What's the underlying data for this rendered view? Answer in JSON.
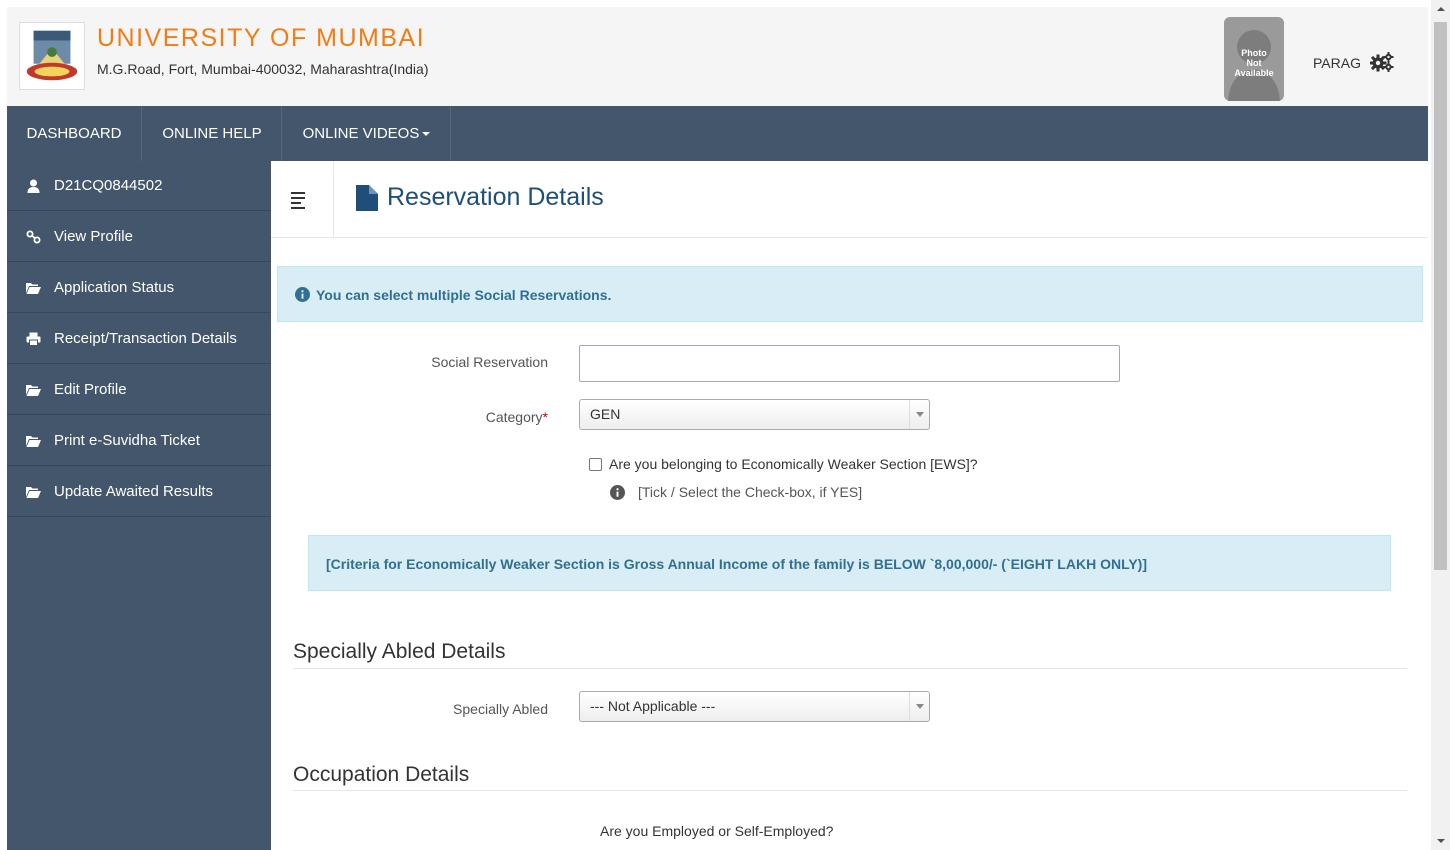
{
  "header": {
    "university_name": "UNIVERSITY OF MUMBAI",
    "address": "M.G.Road, Fort, Mumbai-400032, Maharashtra(India)",
    "photo_placeholder": [
      "Photo",
      "Not",
      "Available"
    ],
    "user_name": "PARAG",
    "settings_icon": "gears-icon",
    "brand_color": "#ef7d16"
  },
  "topnav": {
    "items": [
      {
        "label": "DASHBOARD"
      },
      {
        "label": "ONLINE HELP"
      },
      {
        "label": "ONLINE VIDEOS",
        "dropdown": true
      }
    ]
  },
  "sidebar": {
    "items": [
      {
        "label": "D21CQ0844502",
        "icon": "user-icon"
      },
      {
        "label": "View Profile",
        "icon": "link-icon"
      },
      {
        "label": "Application Status",
        "icon": "folder-icon"
      },
      {
        "label": "Receipt/Transaction Details",
        "icon": "print-icon"
      },
      {
        "label": "Edit Profile",
        "icon": "folder-icon"
      },
      {
        "label": "Print e-Suvidha Ticket",
        "icon": "folder-icon"
      },
      {
        "label": "Update Awaited Results",
        "icon": "folder-icon"
      }
    ],
    "background": "#43566b"
  },
  "page": {
    "title": "Reservation Details",
    "info_alert": "You can select multiple Social Reservations.",
    "social_reservation": {
      "label": "Social Reservation",
      "value": ""
    },
    "category": {
      "label": "Category",
      "required_mark": "*",
      "value": "GEN"
    },
    "ews": {
      "label": "Are you belonging to Economically Weaker Section [EWS]?",
      "checked": false,
      "hint": "[Tick / Select the Check-box, if YES]"
    },
    "ews_criteria": "[Criteria for Economically Weaker Section is Gross Annual Income of the family is BELOW `8,00,000/- (`EIGHT LAKH ONLY)]",
    "specially_abled_section": {
      "title": "Specially Abled Details",
      "label": "Specially Abled",
      "value": "--- Not Applicable ---"
    },
    "occupation_section": {
      "title": "Occupation Details",
      "question": "Are you Employed or Self-Employed?"
    }
  }
}
